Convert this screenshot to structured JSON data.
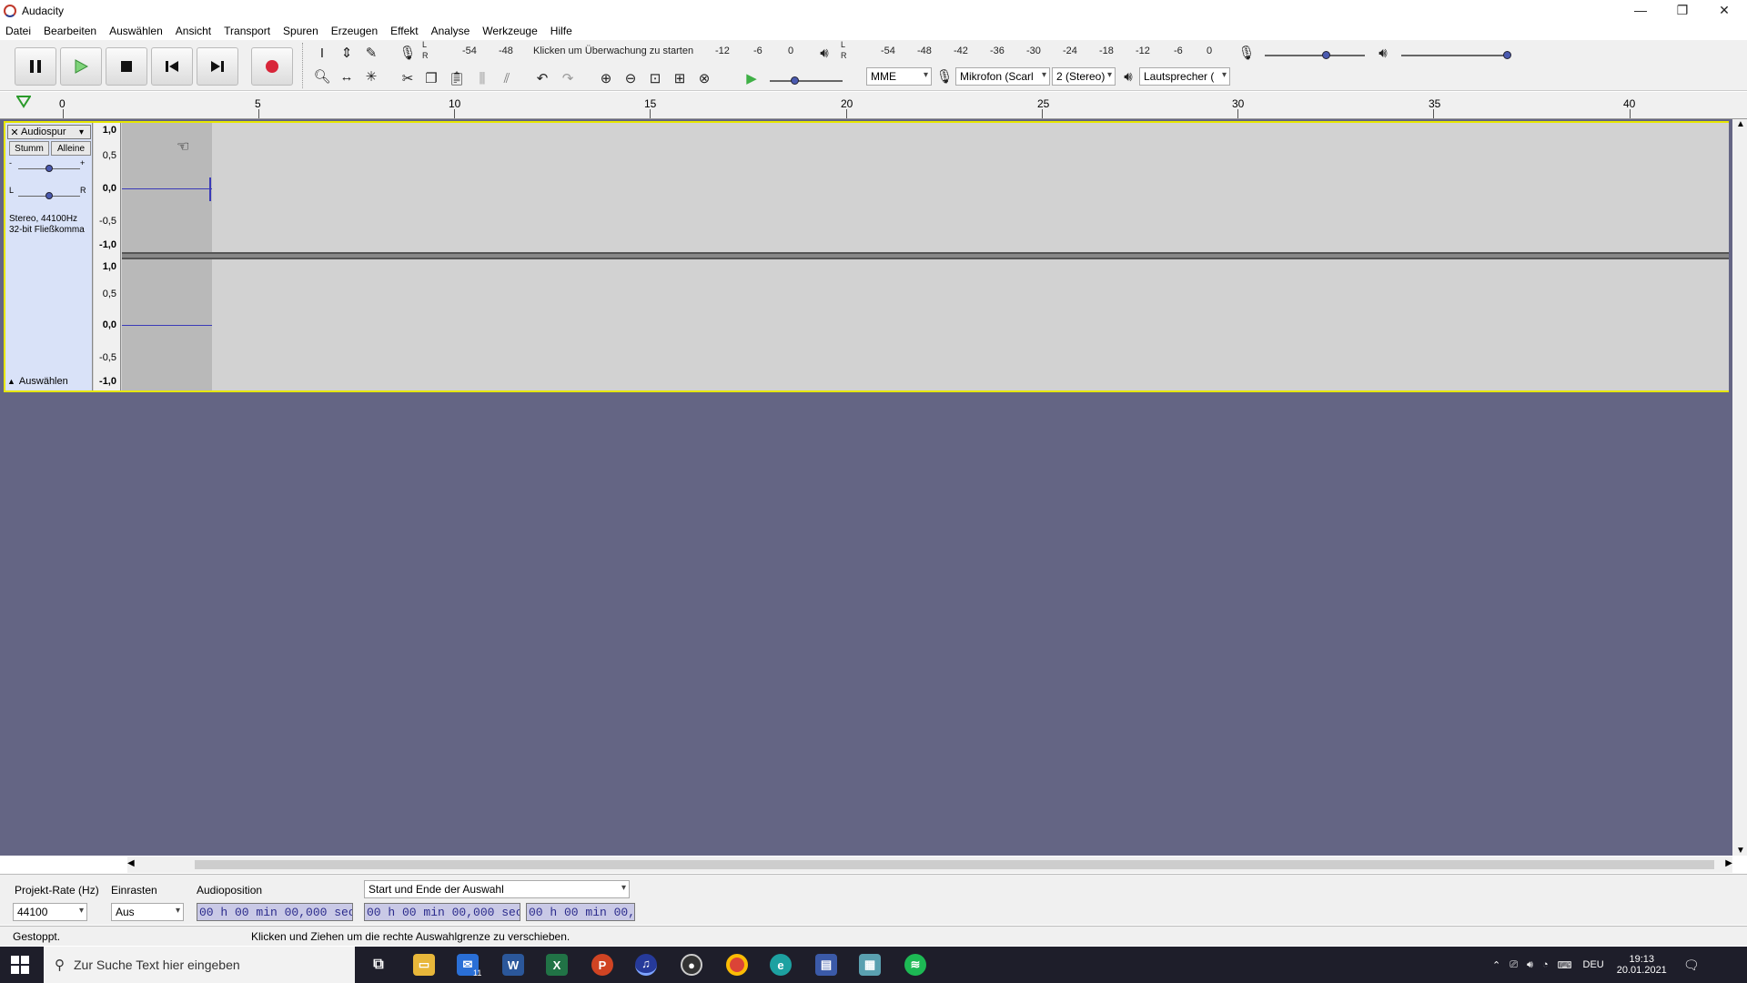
{
  "window": {
    "title": "Audacity",
    "controls": {
      "minimize": "—",
      "restore": "❐",
      "close": "✕"
    }
  },
  "menu": [
    "Datei",
    "Bearbeiten",
    "Auswählen",
    "Ansicht",
    "Transport",
    "Spuren",
    "Erzeugen",
    "Effekt",
    "Analyse",
    "Werkzeuge",
    "Hilfe"
  ],
  "recording_meter": {
    "channels": [
      "L",
      "R"
    ],
    "ticks": [
      "-54",
      "-48",
      "-12",
      "-6",
      "0"
    ],
    "prompt": "Klicken um Überwachung zu starten"
  },
  "playback_meter": {
    "channels": [
      "L",
      "R"
    ],
    "ticks": [
      "-54",
      "-48",
      "-42",
      "-36",
      "-30",
      "-24",
      "-18",
      "-12",
      "-6",
      "0"
    ]
  },
  "device_toolbar": {
    "host": "MME",
    "input_device": "Mikrofon (Scarl",
    "channels": "2 (Stereo)",
    "output_device": "Lautsprecher ("
  },
  "ruler": {
    "labels": [
      "0",
      "5",
      "10",
      "15",
      "20",
      "25",
      "30",
      "35",
      "40"
    ]
  },
  "track": {
    "name": "Audiospur",
    "mute_label": "Stumm",
    "solo_label": "Alleine",
    "gain_minus": "-",
    "gain_plus": "+",
    "pan_left": "L",
    "pan_right": "R",
    "info_line1": "Stereo, 44100Hz",
    "info_line2": "32-bit Fließkomma",
    "select_label": "Auswählen",
    "scale_labels": [
      "1,0",
      "0,5",
      "0,0",
      "-0,5",
      "-1,0"
    ],
    "gain_level": 0.5,
    "pan_level": 0.5
  },
  "selection_toolbar": {
    "rate_label": "Projekt-Rate (Hz)",
    "rate_value": "44100",
    "snap_label": "Einrasten",
    "snap_value": "Aus",
    "position_label": "Audioposition",
    "position_value": "00 h 00 min 00,000 sec",
    "range_label": "Start und Ende der Auswahl",
    "start_value": "00 h 00 min 00,000 sec",
    "end_value": "00 h 00 min 00,0"
  },
  "status": {
    "state": "Gestoppt.",
    "hint": "Klicken und Ziehen um die rechte Auswahlgrenze zu verschieben."
  },
  "taskbar": {
    "search_placeholder": "Zur Suche Text hier eingeben",
    "mail_badge": "11",
    "language": "DEU",
    "time": "19:13",
    "date": "20.01.2021"
  },
  "colors": {
    "track_bg": "#646584",
    "selection": "#b9b9b9",
    "waveform": "#3a3ab8",
    "record_red": "#d8263a",
    "play_green": "#3fb046",
    "focus_yellow": "#e6e600"
  }
}
